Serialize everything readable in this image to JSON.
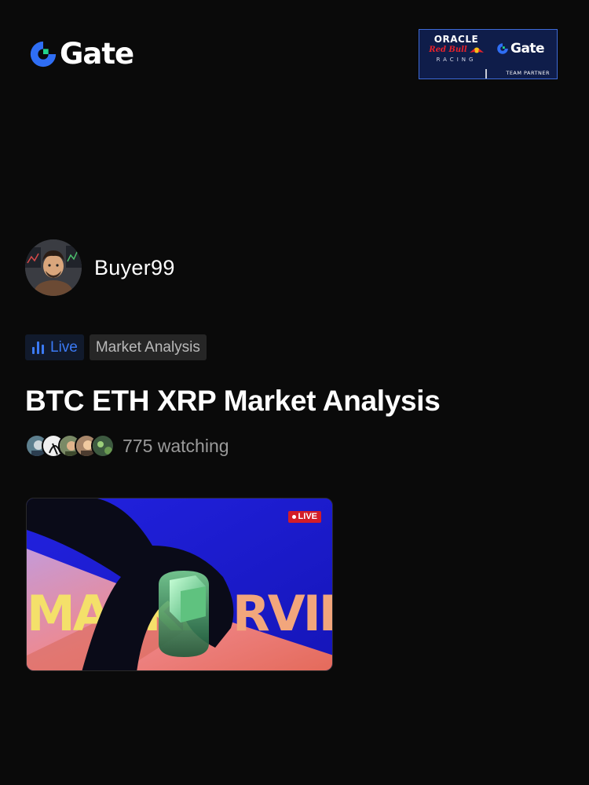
{
  "header": {
    "brand": "Gate",
    "brand_color": "#2f6ef4",
    "partner": {
      "line1": "ORACLE",
      "line2": "Red Bull",
      "line3": "RACING",
      "brand": "Gate",
      "tag": "TEAM PARTNER"
    }
  },
  "streamer": {
    "name": "Buyer99",
    "avatar_icon": "avatar-icon"
  },
  "tags": {
    "live_label": "Live",
    "topic_label": "Market Analysis"
  },
  "stream": {
    "title": "BTC ETH XRP Market Analysis",
    "watching": "775 watching",
    "thumbnail": {
      "badge": "LIVE",
      "text_left": "MARKE",
      "text_right": "RVIEW"
    }
  }
}
